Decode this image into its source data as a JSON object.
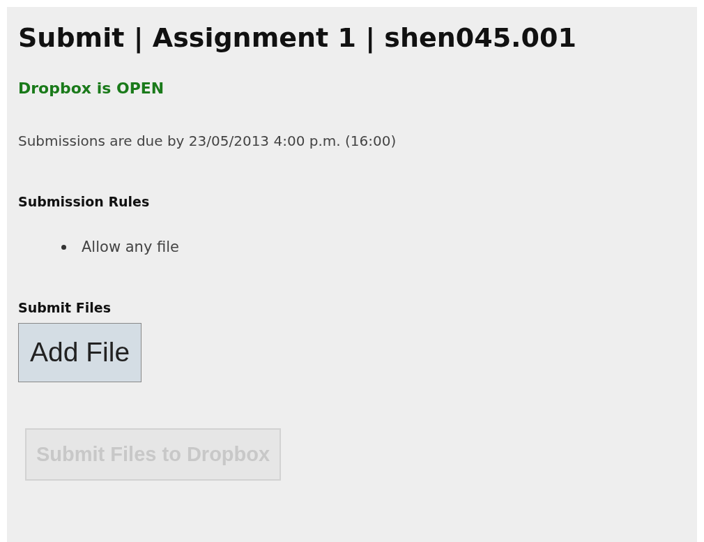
{
  "title": "Submit | Assignment 1 | shen045.001",
  "status": {
    "text": "Dropbox is OPEN",
    "open": true
  },
  "due_text": "Submissions are due by 23/05/2013 4:00 p.m. (16:00)",
  "rules": {
    "heading": "Submission Rules",
    "items": [
      "Allow any file"
    ]
  },
  "submit_files": {
    "heading": "Submit Files",
    "add_button": "Add File"
  },
  "submit_button": {
    "label": "Submit Files to Dropbox",
    "disabled": true
  }
}
